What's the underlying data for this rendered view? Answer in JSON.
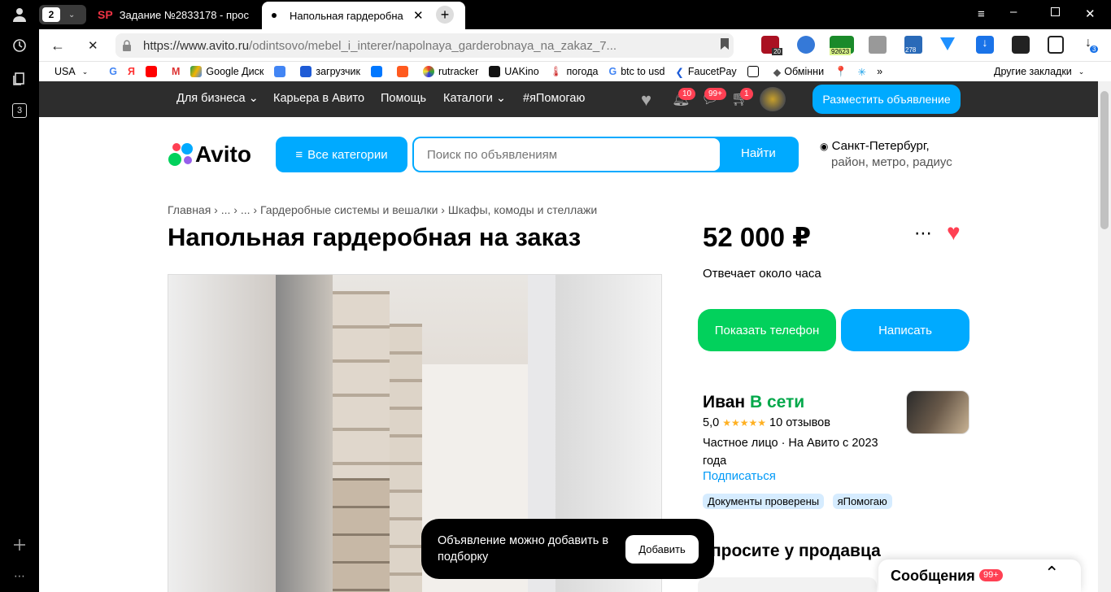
{
  "browser": {
    "tab_counter": "2",
    "tabs": [
      {
        "favicon": "SP",
        "title": "Задание №2833178 - прос"
      },
      {
        "title": "Напольная гардеробна"
      }
    ],
    "url_domain": "https://www.avito.ru",
    "url_path": "/odintsovo/mebel_i_interer/napolnaya_garderobnaya_na_zakaz_7...",
    "sidebar_badge": "3",
    "ext_badges": [
      "20",
      "92623",
      "278",
      "3"
    ],
    "bookmarks": [
      "USA",
      "Google Диск",
      "загрузчик",
      "rutracker",
      "UAKino",
      "погода",
      "btc to usd",
      "FaucetPay",
      "Обмінни"
    ],
    "other_bookmarks": "Другие закладки"
  },
  "topnav": {
    "items": [
      "Для бизнеса",
      "Карьера в Авито",
      "Помощь",
      "Каталоги",
      "#яПомогаю"
    ],
    "badges": [
      "10",
      "99+",
      "1"
    ],
    "post_button": "Разместить объявление"
  },
  "header": {
    "logo": "Avito",
    "categories_button": "Все категории",
    "search_placeholder": "Поиск по объявлениям",
    "search_button": "Найти",
    "city": "Санкт-Петербург,",
    "city_sub": "район, метро, радиус"
  },
  "breadcrumbs": [
    "Главная",
    "...",
    "...",
    "Гардеробные системы и вешалки",
    "Шкафы, комоды и стеллажи"
  ],
  "listing": {
    "title": "Напольная гардеробная на заказ",
    "price": "52 000 ₽",
    "response_time": "Отвечает около часа",
    "show_phone": "Показать телефон",
    "write": "Написать"
  },
  "seller": {
    "name": "Иван",
    "status": "В сети",
    "rating": "5,0",
    "stars": "★★★★★",
    "reviews": "10 отзывов",
    "type_line1": "Частное лицо · На Авито с 2023",
    "type_line2": "года",
    "subscribe": "Подписаться",
    "tags": [
      "Документы проверены",
      "яПомогаю"
    ]
  },
  "ask_title": "просите у продавца",
  "toast": {
    "text": "Объявление можно добавить в подборку",
    "button": "Добавить"
  },
  "messages": {
    "label": "Сообщения",
    "badge": "99+"
  },
  "colors": {
    "accent": "#00aaff",
    "green": "#02d15c",
    "red": "#ff4053",
    "dark": "#2d2d2d"
  }
}
